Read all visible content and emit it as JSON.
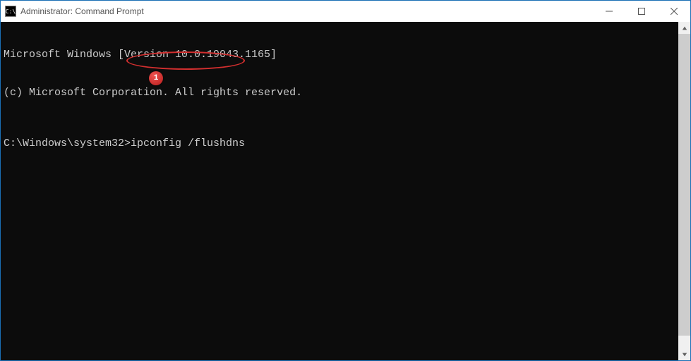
{
  "window": {
    "icon_text": "C:\\",
    "title": "Administrator: Command Prompt"
  },
  "terminal": {
    "line1": "Microsoft Windows [Version 10.0.19043.1165]",
    "line2": "(c) Microsoft Corporation. All rights reserved.",
    "prompt": "C:\\Windows\\system32>",
    "command": "ipconfig /flushdns"
  },
  "annotation": {
    "badge_number": "1"
  }
}
